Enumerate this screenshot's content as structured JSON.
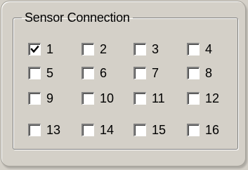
{
  "group": {
    "title": "Sensor Connection"
  },
  "checkboxes": [
    {
      "label": "1",
      "checked": true
    },
    {
      "label": "2",
      "checked": false
    },
    {
      "label": "3",
      "checked": false
    },
    {
      "label": "4",
      "checked": false
    },
    {
      "label": "5",
      "checked": false
    },
    {
      "label": "6",
      "checked": false
    },
    {
      "label": "7",
      "checked": false
    },
    {
      "label": "8",
      "checked": false
    },
    {
      "label": "9",
      "checked": false
    },
    {
      "label": "10",
      "checked": false
    },
    {
      "label": "11",
      "checked": false
    },
    {
      "label": "12",
      "checked": false
    },
    {
      "label": "13",
      "checked": false
    },
    {
      "label": "14",
      "checked": false
    },
    {
      "label": "15",
      "checked": false
    },
    {
      "label": "16",
      "checked": false
    }
  ]
}
